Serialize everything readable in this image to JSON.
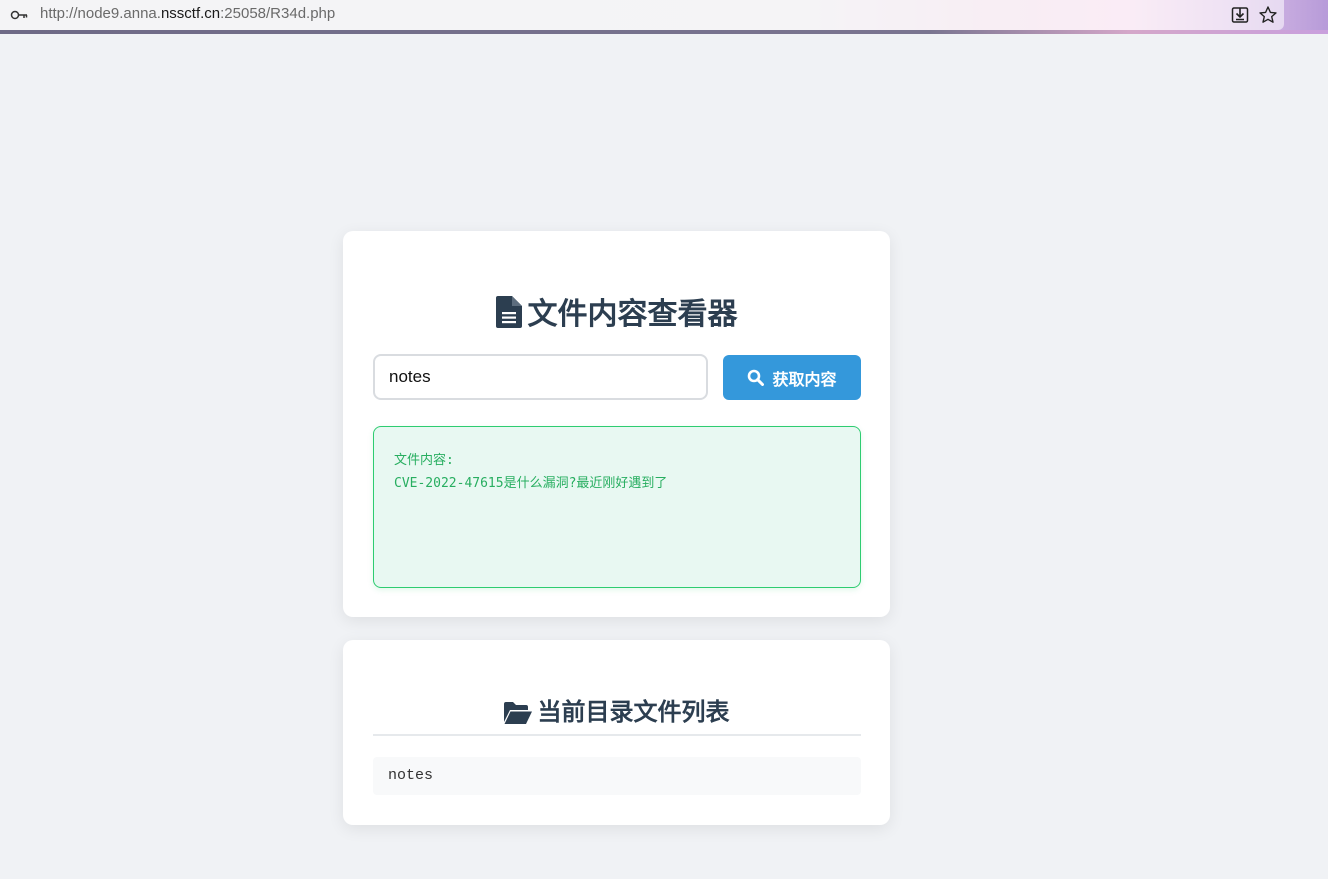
{
  "browser": {
    "url_prefix": "http://node9.anna.",
    "url_host": "nssctf.cn",
    "url_suffix": ":25058/R34d.php"
  },
  "viewer": {
    "title": "文件内容查看器",
    "input_value": "notes",
    "button_label": "获取内容",
    "result_label": "文件内容:",
    "result_text": "CVE-2022-47615是什么漏洞?最近刚好遇到了"
  },
  "files": {
    "title": "当前目录文件列表",
    "items": [
      "notes"
    ]
  },
  "colors": {
    "accent": "#3498db",
    "success": "#27ae60",
    "title": "#2c3e50"
  }
}
